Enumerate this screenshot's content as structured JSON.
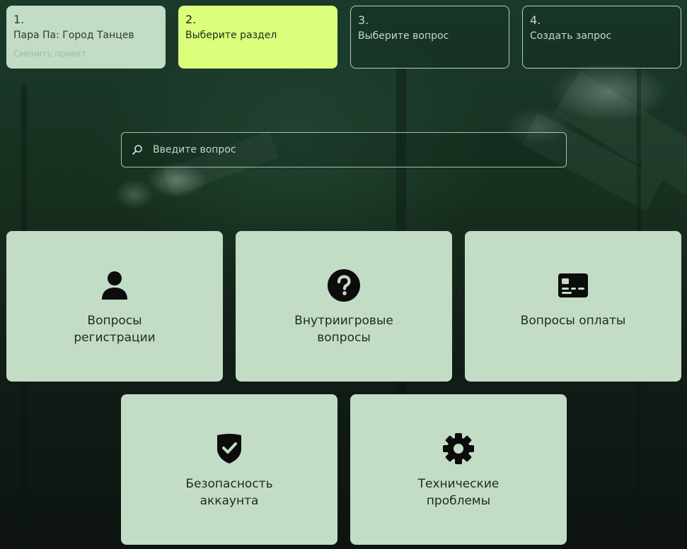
{
  "steps": [
    {
      "number": "1.",
      "title": "Пара Па: Город Танцев",
      "link": "Сменить проект",
      "state": "done"
    },
    {
      "number": "2.",
      "title": "Выберите раздел",
      "state": "active"
    },
    {
      "number": "3.",
      "title": "Выберите вопрос",
      "state": "pending"
    },
    {
      "number": "4.",
      "title": "Создать запрос",
      "state": "pending"
    }
  ],
  "search": {
    "placeholder": "Введите вопрос",
    "icon": "search-icon"
  },
  "categories": [
    {
      "label": "Вопросы регистрации",
      "icon": "user-icon"
    },
    {
      "label": "Внутриигровые вопросы",
      "icon": "question-icon"
    },
    {
      "label": "Вопросы оплаты",
      "icon": "credit-card-icon"
    },
    {
      "label": "Безопасность аккаунта",
      "icon": "shield-check-icon"
    },
    {
      "label": "Технические проблемы",
      "icon": "gear-icon"
    }
  ],
  "colors": {
    "card_bg": "#c3dcc6",
    "active_step_bg": "#dbff7a",
    "background": "#17301f"
  }
}
